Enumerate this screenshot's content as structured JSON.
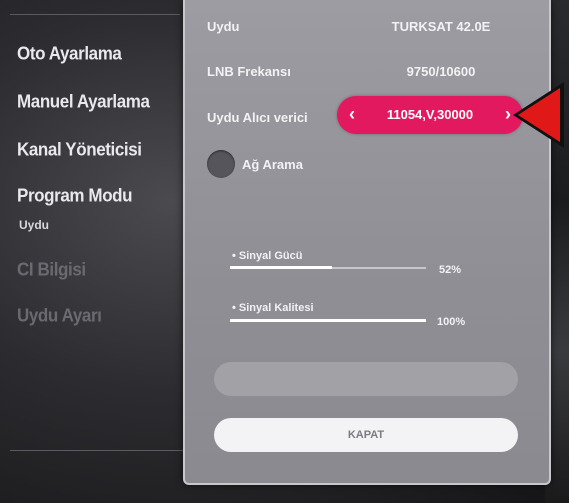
{
  "menu": {
    "items": [
      {
        "label": "Oto Ayarlama"
      },
      {
        "label": "Manuel Ayarlama"
      },
      {
        "label": "Kanal Yöneticisi"
      },
      {
        "label": "Program Modu",
        "sub": "Uydu"
      },
      {
        "label": "CI Bilgisi"
      },
      {
        "label": "Uydu Ayarı"
      }
    ]
  },
  "dialog": {
    "satellite_label": "Uydu",
    "satellite_value": "TURKSAT 42.0E",
    "lnb_label": "LNB Frekansı",
    "lnb_value": "9750/10600",
    "transponder_label": "Uydu Alıcı verici",
    "transponder_value": "11054,V,30000",
    "network_search_label": "Ağ Arama",
    "signal_strength": {
      "label": "• Sinyal Gücü",
      "percent_text": "52%",
      "level": 0.52
    },
    "signal_quality": {
      "label": "• Sinyal Kalitesi",
      "percent_text": "100%",
      "level": 1.0
    },
    "close_button": "KAPAT"
  },
  "colors": {
    "accent": "#e3195f",
    "pointer": "#e01818"
  }
}
